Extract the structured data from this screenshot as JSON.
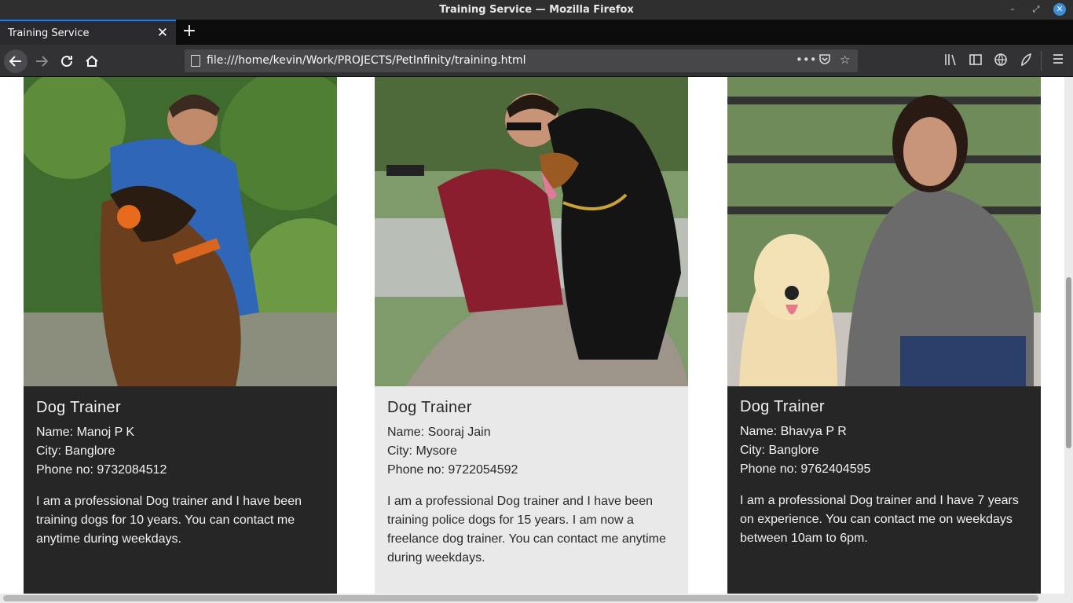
{
  "window": {
    "title": "Training Service — Mozilla Firefox"
  },
  "tabs": [
    {
      "label": "Training Service",
      "close": "✕"
    }
  ],
  "newtab": "+",
  "nav": {
    "url": "file:///home/kevin/Work/PROJECTS/PetInfinity/training.html"
  },
  "trainers": [
    {
      "role": "Dog Trainer",
      "name": "Name: Manoj P K",
      "city": "City: Banglore",
      "phone": "Phone no: 9732084512",
      "bio": "I am a professional Dog trainer and I have been training dogs for 10 years. You can contact me anytime during weekdays."
    },
    {
      "role": "Dog Trainer",
      "name": "Name: Sooraj Jain",
      "city": "City: Mysore",
      "phone": "Phone no: 9722054592",
      "bio": "I am a professional Dog trainer and I have been training police dogs for 15 years. I am now a freelance dog trainer. You can contact me anytime during weekdays."
    },
    {
      "role": "Dog Trainer",
      "name": "Name: Bhavya P R",
      "city": "City: Banglore",
      "phone": "Phone no: 9762404595",
      "bio": "I am a professional Dog trainer and I have 7 years on experience. You can contact me on weekdays between 10am to 6pm."
    }
  ],
  "colors": {
    "accent": "#0a84ff",
    "card_dark": "#262626",
    "card_light": "#e9e9e9"
  }
}
